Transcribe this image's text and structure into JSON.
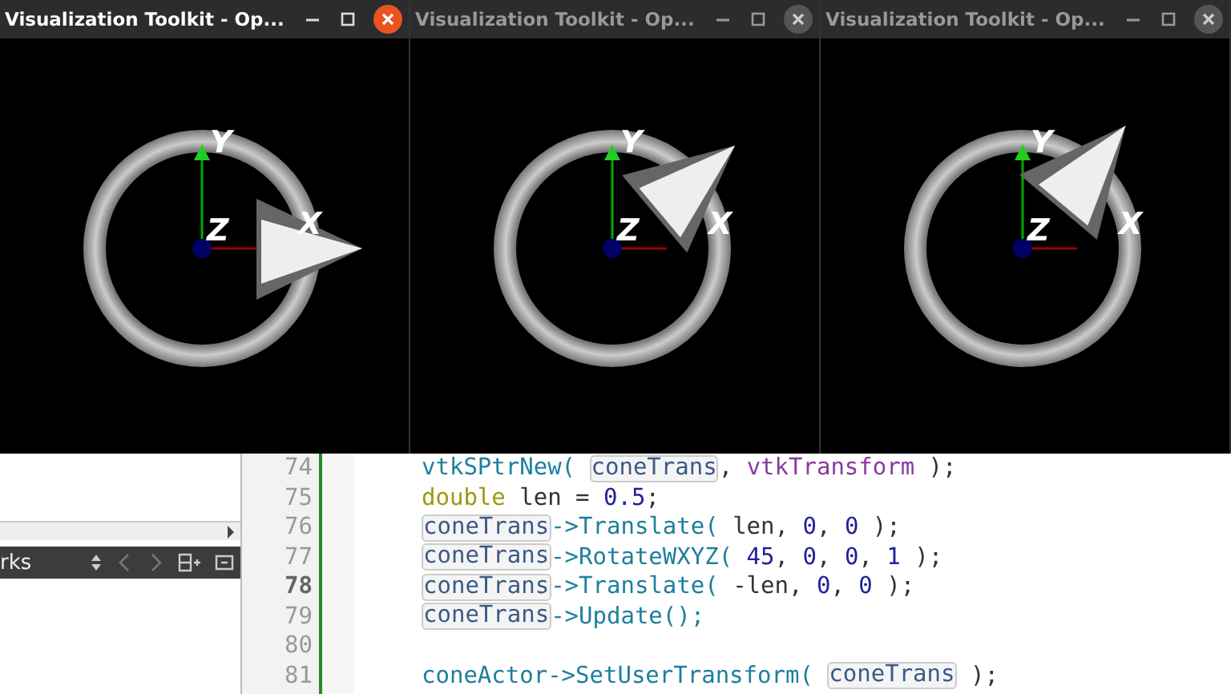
{
  "windows": [
    {
      "title": "Visualization Toolkit - Op...",
      "active": true,
      "kind": "translate",
      "axes": {
        "y": "Y",
        "z": "Z",
        "x": "X"
      }
    },
    {
      "title": "Visualization Toolkit - Op...",
      "active": false,
      "kind": "rotate",
      "axes": {
        "y": "Y",
        "z": "Z",
        "x": "X"
      }
    },
    {
      "title": "Visualization Toolkit - Op...",
      "active": false,
      "kind": "translate-back",
      "axes": {
        "y": "Y",
        "z": "Z",
        "x": "X"
      }
    }
  ],
  "side_panel": {
    "title": "rks"
  },
  "editor": {
    "lines": [
      {
        "number": "74",
        "current": false,
        "tokens": [
          {
            "text": "vtkSPtrNew( ",
            "kind": "func"
          },
          {
            "text": "coneTrans",
            "kind": "var"
          },
          {
            "text": ", ",
            "kind": "plain"
          },
          {
            "text": "vtkTransform",
            "kind": "class"
          },
          {
            "text": " );",
            "kind": "plain"
          }
        ]
      },
      {
        "number": "75",
        "current": false,
        "tokens": [
          {
            "text": "double",
            "kind": "type"
          },
          {
            "text": " len = ",
            "kind": "plain"
          },
          {
            "text": "0.5",
            "kind": "num"
          },
          {
            "text": ";",
            "kind": "plain"
          }
        ]
      },
      {
        "number": "76",
        "current": false,
        "tokens": [
          {
            "text": "coneTrans",
            "kind": "var"
          },
          {
            "text": "->Translate(",
            "kind": "func"
          },
          {
            "text": " len, ",
            "kind": "plain"
          },
          {
            "text": "0",
            "kind": "num"
          },
          {
            "text": ", ",
            "kind": "plain"
          },
          {
            "text": "0",
            "kind": "num"
          },
          {
            "text": " );",
            "kind": "plain"
          }
        ]
      },
      {
        "number": "77",
        "current": false,
        "tokens": [
          {
            "text": "coneTrans",
            "kind": "var"
          },
          {
            "text": "->RotateWXYZ( ",
            "kind": "func"
          },
          {
            "text": "45",
            "kind": "num"
          },
          {
            "text": ", ",
            "kind": "plain"
          },
          {
            "text": "0",
            "kind": "num"
          },
          {
            "text": ", ",
            "kind": "plain"
          },
          {
            "text": "0",
            "kind": "num"
          },
          {
            "text": ", ",
            "kind": "plain"
          },
          {
            "text": "1",
            "kind": "num"
          },
          {
            "text": " );",
            "kind": "plain"
          }
        ]
      },
      {
        "number": "78",
        "current": true,
        "tokens": [
          {
            "text": "coneTrans",
            "kind": "var"
          },
          {
            "text": "->Translate(",
            "kind": "func"
          },
          {
            "text": " -len, ",
            "kind": "plain"
          },
          {
            "text": "0",
            "kind": "num"
          },
          {
            "text": ", ",
            "kind": "plain"
          },
          {
            "text": "0",
            "kind": "num"
          },
          {
            "text": " );",
            "kind": "plain"
          }
        ]
      },
      {
        "number": "79",
        "current": false,
        "tokens": [
          {
            "text": "coneTrans",
            "kind": "var"
          },
          {
            "text": "->Update();",
            "kind": "func"
          }
        ]
      },
      {
        "number": "80",
        "current": false
      },
      {
        "number": "81",
        "current": false,
        "tokens": [
          {
            "text": "coneActor->SetUserTransform( ",
            "kind": "func"
          },
          {
            "text": "coneTrans",
            "kind": "var"
          },
          {
            "text": " );",
            "kind": "plain"
          }
        ]
      }
    ]
  }
}
